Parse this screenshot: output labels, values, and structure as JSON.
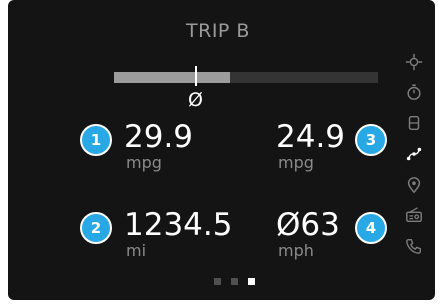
{
  "header": {
    "title": "TRIP B"
  },
  "comparison_bar": {
    "average_symbol": "Ø",
    "fill_fraction": 0.44
  },
  "metrics": [
    {
      "badge": "1",
      "value": "29.9",
      "unit": "mpg"
    },
    {
      "badge": "3",
      "value": "24.9",
      "unit": "mpg"
    },
    {
      "badge": "2",
      "value": "1234.5",
      "unit": "mi"
    },
    {
      "badge": "4",
      "value": "Ø63",
      "unit": "mph"
    }
  ],
  "pagination": {
    "pages": 3,
    "active": 3
  },
  "sidebar": {
    "icons": [
      "crosshair-icon",
      "stopwatch-icon",
      "seat-icon",
      "route-icon",
      "location-pin-icon",
      "radio-icon",
      "phone-icon"
    ],
    "active": "route-icon"
  },
  "colors": {
    "badge": "#29a8e6",
    "background": "#141414",
    "accent_text": "#ffffff"
  }
}
